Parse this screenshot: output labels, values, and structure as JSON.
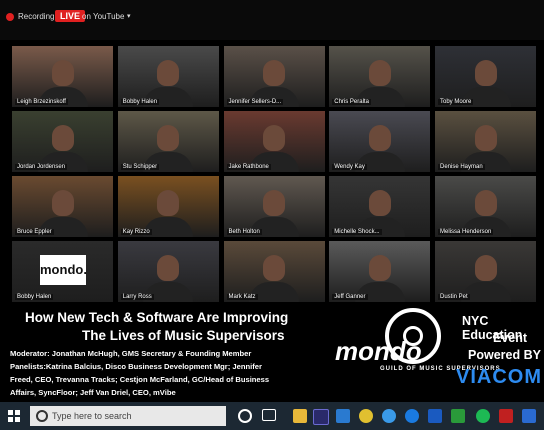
{
  "top_bar": {
    "recording_label": "Recording",
    "live_badge": "LIVE",
    "destination_label": "on YouTube"
  },
  "participants": [
    {
      "name": "Leigh Brzezinskoff",
      "color": "#7a5a4a",
      "active": true
    },
    {
      "name": "Bobby Halen",
      "color": "#4a4a4a"
    },
    {
      "name": "Jennifer Sellers-D...",
      "color": "#5a5048"
    },
    {
      "name": "Chris Peralta",
      "color": "#55524a"
    },
    {
      "name": "Toby Moore",
      "color": "#2e3036"
    },
    {
      "name": "Jordan Jordensen",
      "color": "#3a4030"
    },
    {
      "name": "Stu Schipper",
      "color": "#5e5848"
    },
    {
      "name": "Jake Rathbone",
      "color": "#6a3a30"
    },
    {
      "name": "Wendy Kay",
      "color": "#4a4a52"
    },
    {
      "name": "Denise Hayman",
      "color": "#5a5040"
    },
    {
      "name": "Bruce Eppler",
      "color": "#6a4a30"
    },
    {
      "name": "Kay Rizzo",
      "color": "#7a5020"
    },
    {
      "name": "Beth Holton",
      "color": "#605850"
    },
    {
      "name": "Michelle Shock...",
      "color": "#353535"
    },
    {
      "name": "Melissa Henderson",
      "color": "#4a4a48"
    },
    {
      "name": "Bobby Halen",
      "color": "#2a2a2a",
      "logo": "mondo."
    },
    {
      "name": "Larry Ross",
      "color": "#3a3a40"
    },
    {
      "name": "Mark Katz",
      "color": "#5a4a3a"
    },
    {
      "name": "Jeff Ganner",
      "color": "#5a5a5a"
    },
    {
      "name": "Dustin Pet",
      "color": "#3a3836"
    }
  ],
  "banner": {
    "title_line1": "How New Tech & Software Are Improving",
    "title_line2": "The Lives of Music Supervisors",
    "line1": "Moderator: Jonathan McHugh, GMS Secretary & Founding Member",
    "line2": "Panelists:Katrina Balcius, Disco Business Development Mgr; Jennifer",
    "line3": "Freed, CEO, Trevanna Tracks; Cestjon McFarland, GC/Head of Business",
    "line4": "Affairs, SyncFloor; Jeff Van Driel, CEO, mVibe",
    "mondo_logo": "mondo",
    "seal_text": "GUILD OF MUSIC SUPERVISORS",
    "nyc_line1": "NYC Education",
    "nyc_line2": "Event",
    "nyc_line3": "Powered BY",
    "viacom": "VIACOM"
  },
  "taskbar": {
    "search_placeholder": "Type here to search"
  }
}
